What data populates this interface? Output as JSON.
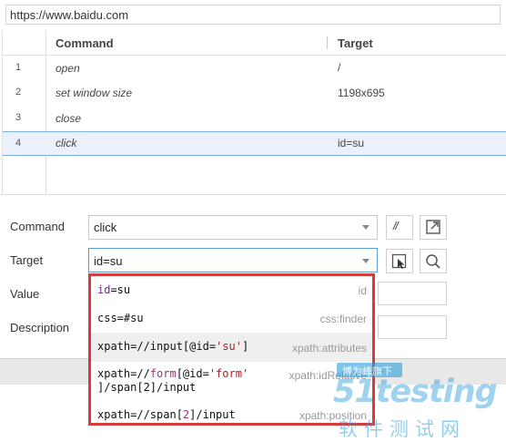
{
  "url": "https://www.baidu.com",
  "table": {
    "headers": {
      "command": "Command",
      "target": "Target"
    },
    "rows": [
      {
        "num": "1",
        "command": "open",
        "target": "/"
      },
      {
        "num": "2",
        "command": "set window size",
        "target": "1198x695"
      },
      {
        "num": "3",
        "command": "close",
        "target": ""
      },
      {
        "num": "4",
        "command": "click",
        "target": "id=su"
      }
    ]
  },
  "form": {
    "command_label": "Command",
    "command_value": "click",
    "comment_btn": "//",
    "target_label": "Target",
    "target_value": "id=su",
    "value_label": "Value",
    "description_label": "Description"
  },
  "locators": [
    {
      "value": "id=su",
      "type": "id"
    },
    {
      "value": "css=#su",
      "type": "css:finder"
    },
    {
      "value": "xpath=//input[@id='su']",
      "type": "xpath:attributes"
    },
    {
      "value": "xpath=//form[@id='form']/span[2]/input",
      "line1": "xpath=//form[@id='form'",
      "line2": "]/span[2]/input",
      "type": "xpath:idRelative"
    },
    {
      "value": "xpath=//span[2]/input",
      "type": "xpath:position"
    }
  ],
  "watermark": {
    "badge": "博为峰旗下",
    "logo": "51testing",
    "subtitle": "软件测试网"
  },
  "colors": {
    "highlight_border": "#d83b3b",
    "selected_row": "#eaf1fb",
    "accent_blue": "#2d9cdb"
  }
}
